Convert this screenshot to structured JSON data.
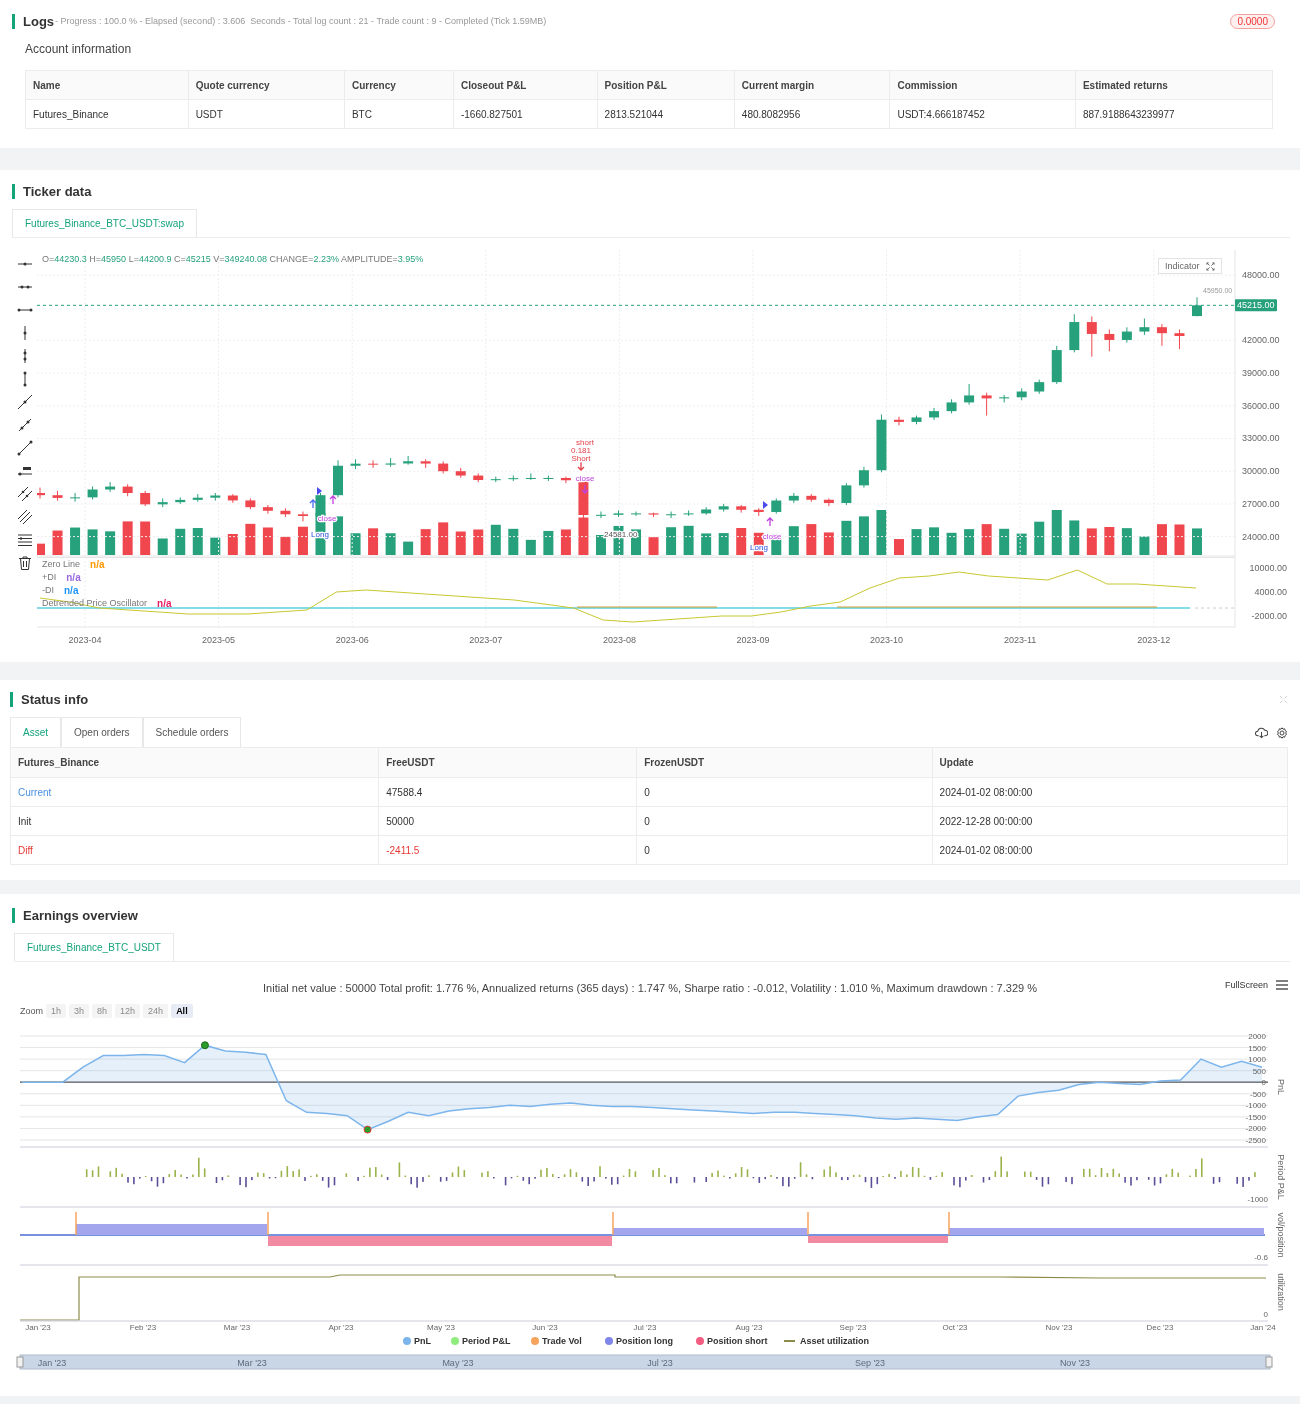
{
  "logs": {
    "title": "Logs",
    "summary": "- Progress : 100.0 % - Elapsed (second) : 3.606  Seconds - Total log count : 21 - Trade count : 9 - Completed (Tick 1.59MB)",
    "badge": "0.0000",
    "account": {
      "title": "Account information",
      "columns": [
        "Name",
        "Quote currency",
        "Currency",
        "Closeout P&L",
        "Position P&L",
        "Current margin",
        "Commission",
        "Estimated returns"
      ],
      "rows": [
        [
          "Futures_Binance",
          "USDT",
          "BTC",
          "-1660.827501",
          "2813.521044",
          "480.8082956",
          "USDT:4.666187452",
          "887.9188643239977"
        ]
      ]
    }
  },
  "ticker": {
    "title": "Ticker data",
    "tabs": [
      {
        "label": "Futures_Binance_BTC_USDT:swap",
        "selected": true
      }
    ],
    "ohlc": [
      {
        "label": "O=",
        "value": "44230.3"
      },
      {
        "label": "H=",
        "value": "45950"
      },
      {
        "label": "L=",
        "value": "44200.9"
      },
      {
        "label": "C=",
        "value": "45215"
      },
      {
        "label": "V=",
        "value": "349240.08"
      },
      {
        "label": "CHANGE=",
        "value": "2.23%"
      },
      {
        "label": "AMPLITUDE=",
        "value": "3.95%"
      }
    ],
    "indicator_button": "Indicator",
    "high_label": "45950.00",
    "last_price": "45215.00",
    "price_chart": {
      "chart_data": {
        "type": "candlestick",
        "ylim": [
          22130,
          50290
        ],
        "grid": true,
        "yticks": [
          {
            "value": 48000,
            "label": "48000.00"
          },
          {
            "value": 42000,
            "label": "42000.00"
          },
          {
            "value": 39000,
            "label": "39000.00"
          },
          {
            "value": 36000,
            "label": "36000.00"
          },
          {
            "value": 33000,
            "label": "33000.00"
          },
          {
            "value": 30000,
            "label": "30000.00"
          },
          {
            "value": 27000,
            "label": "27000.00"
          },
          {
            "value": 24000,
            "label": "24000.00"
          }
        ],
        "ohlc": [
          [
            28000,
            28500,
            27500,
            27800
          ],
          [
            27800,
            28200,
            27300,
            27550
          ],
          [
            27550,
            28000,
            27200,
            27600
          ],
          [
            27600,
            28600,
            27400,
            28320
          ],
          [
            28320,
            29000,
            28100,
            28590
          ],
          [
            28590,
            28800,
            27700,
            28000
          ],
          [
            28000,
            28200,
            26800,
            26960
          ],
          [
            26960,
            27500,
            26700,
            27160
          ],
          [
            27160,
            27600,
            27000,
            27370
          ],
          [
            27370,
            27900,
            27200,
            27570
          ],
          [
            27570,
            28000,
            27300,
            27770
          ],
          [
            27770,
            27900,
            27100,
            27320
          ],
          [
            27320,
            27500,
            26500,
            26700
          ],
          [
            26700,
            26900,
            26100,
            26370
          ],
          [
            26370,
            26600,
            25800,
            26050
          ],
          [
            26050,
            26300,
            25400,
            25890
          ],
          [
            25890,
            28000,
            25700,
            27800
          ],
          [
            27800,
            31000,
            27600,
            30500
          ],
          [
            30500,
            31100,
            30200,
            30690
          ],
          [
            30690,
            31000,
            30300,
            30600
          ],
          [
            30600,
            31200,
            30400,
            30710
          ],
          [
            30710,
            31400,
            30600,
            30910
          ],
          [
            30910,
            31100,
            30300,
            30700
          ],
          [
            30700,
            30900,
            29800,
            30000
          ],
          [
            30000,
            30300,
            29400,
            29600
          ],
          [
            29600,
            29800,
            29000,
            29190
          ],
          [
            29190,
            29500,
            29000,
            29270
          ],
          [
            29270,
            29600,
            29100,
            29360
          ],
          [
            29360,
            29800,
            29200,
            29380
          ],
          [
            29380,
            29600,
            29100,
            29380
          ],
          [
            29380,
            29500,
            28900,
            29170
          ],
          [
            29170,
            29300,
            25400,
            25980
          ],
          [
            25980,
            26300,
            25700,
            26000
          ],
          [
            26000,
            26400,
            25800,
            26130
          ],
          [
            26130,
            26300,
            25900,
            26130
          ],
          [
            26130,
            26200,
            25800,
            26020
          ],
          [
            26020,
            26300,
            25700,
            26050
          ],
          [
            26050,
            26400,
            25900,
            26130
          ],
          [
            26130,
            26700,
            26000,
            26490
          ],
          [
            26490,
            27000,
            26300,
            26780
          ],
          [
            26780,
            26900,
            26200,
            26460
          ],
          [
            26460,
            26600,
            25900,
            26260
          ],
          [
            26260,
            27500,
            26100,
            27310
          ],
          [
            27310,
            28000,
            27100,
            27740
          ],
          [
            27740,
            27900,
            27200,
            27380
          ],
          [
            27380,
            27500,
            26800,
            27080
          ],
          [
            27080,
            28900,
            26900,
            28700
          ],
          [
            28700,
            30400,
            28500,
            30090
          ],
          [
            30090,
            35200,
            29900,
            34720
          ],
          [
            34720,
            35000,
            34200,
            34520
          ],
          [
            34520,
            35100,
            34300,
            34930
          ],
          [
            34930,
            35800,
            34700,
            35510
          ],
          [
            35510,
            36600,
            35300,
            36310
          ],
          [
            36310,
            38000,
            36100,
            36950
          ],
          [
            36950,
            37200,
            35100,
            36680
          ],
          [
            36680,
            37000,
            36300,
            36780
          ],
          [
            36780,
            37600,
            36500,
            37310
          ],
          [
            37310,
            38400,
            37100,
            38170
          ],
          [
            38170,
            41500,
            38000,
            41110
          ],
          [
            41110,
            44400,
            40900,
            43680
          ],
          [
            43680,
            44200,
            40500,
            42590
          ],
          [
            42590,
            43000,
            41000,
            42040
          ],
          [
            42040,
            43200,
            41800,
            42810
          ],
          [
            42810,
            44000,
            42500,
            43210
          ],
          [
            43210,
            43500,
            41500,
            42660
          ],
          [
            42660,
            43000,
            41200,
            42400
          ],
          [
            44230.3,
            45950,
            44200.9,
            45215
          ]
        ]
      }
    },
    "dates": [
      "2023-04",
      "2023-05",
      "2023-06",
      "2023-07",
      "2023-08",
      "2023-09",
      "2023-10",
      "2023-11",
      "2023-12"
    ],
    "legend": [
      {
        "name": "Zero Line",
        "value": "n/a",
        "color": "#ff9800"
      },
      {
        "name": "+DI",
        "value": "n/a",
        "color": "#9c6ade"
      },
      {
        "name": "-DI",
        "value": "n/a",
        "color": "#2196f3"
      }
    ],
    "osc_chart": {
      "legend": {
        "value": "n/a",
        "color": "#e91e63"
      },
      "chart_data": {
        "type": "line",
        "ylim": [
          -4750,
          12750
        ],
        "yticks": [
          {
            "value": 10000,
            "label": "10000.00"
          },
          {
            "value": 4000,
            "label": "4000.00"
          },
          {
            "value": -2000,
            "label": "-2000.00"
          }
        ],
        "series": [
          {
            "name": "Detrended Price Oscillator",
            "color": "#c8c832",
            "values": [
              2500,
              1500,
              0,
              -500,
              -1000,
              -1500,
              -1500,
              -1500,
              -1000,
              -500,
              4000,
              4500,
              4000,
              3500,
              3000,
              2500,
              2000,
              1000,
              0,
              -3000,
              -3500,
              -3000,
              -2500,
              -2000,
              -2000,
              -1000,
              500,
              1500,
              5000,
              7500,
              8000,
              9000,
              8000,
              7500,
              7000,
              9500,
              6000,
              6000,
              5500,
              5000
            ]
          }
        ]
      }
    },
    "markers": [
      {
        "text": "short",
        "kind": "short"
      },
      {
        "text": "0.181",
        "kind": "short"
      },
      {
        "text": "Short",
        "kind": "short"
      },
      {
        "text": "close",
        "kind": "close"
      },
      {
        "text": "close",
        "kind": "close"
      },
      {
        "text": "Long",
        "kind": "long"
      },
      {
        "text": "24581.00",
        "kind": "low"
      },
      {
        "text": "close",
        "kind": "close"
      },
      {
        "text": "Long",
        "kind": "long"
      }
    ]
  },
  "status": {
    "title": "Status info",
    "tabs": [
      {
        "label": "Asset",
        "selected": true
      },
      {
        "label": "Open orders",
        "selected": false
      },
      {
        "label": "Schedule orders",
        "selected": false
      }
    ],
    "columns": [
      "Futures_Binance",
      "FreeUSDT",
      "FrozenUSDT",
      "Update"
    ],
    "rows": [
      {
        "kind": "current",
        "cells": [
          "Current",
          "47588.4",
          "0",
          "2024-01-02 08:00:00"
        ]
      },
      {
        "kind": "init",
        "cells": [
          "Init",
          "50000",
          "0",
          "2022-12-28 00:00:00"
        ]
      },
      {
        "kind": "diff",
        "cells": [
          "Diff",
          "-2411.5",
          "0",
          "2024-01-02 08:00:00"
        ]
      }
    ]
  },
  "earnings": {
    "title": "Earnings overview",
    "tabs": [
      {
        "label": "Futures_Binance_BTC_USDT",
        "selected": true
      }
    ],
    "summary": "Initial net value : 50000 Total profit: 1.776 %, Annualized returns (365 days) : 1.747 %, Sharpe ratio : -0.012, Volatility : 1.010 %, Maximum drawdown : 7.329 %",
    "fullscreen": "FullScreen",
    "zoom_label": "Zoom",
    "zoom_buttons": [
      {
        "label": "1h",
        "disabled": true,
        "selected": false
      },
      {
        "label": "3h",
        "disabled": true,
        "selected": false
      },
      {
        "label": "8h",
        "disabled": true,
        "selected": false
      },
      {
        "label": "12h",
        "disabled": true,
        "selected": false
      },
      {
        "label": "24h",
        "disabled": true,
        "selected": false
      },
      {
        "label": "All",
        "disabled": false,
        "selected": true
      }
    ],
    "pnl_chart": {
      "chart_data": {
        "type": "line",
        "ylabel": "PnL",
        "grid": true,
        "ylim": [
          -2500,
          2000
        ],
        "yticks": [
          2000,
          1500,
          1000,
          500,
          0,
          -500,
          -1000,
          -1500,
          -2000,
          -2500
        ],
        "series": [
          {
            "name": "PnL",
            "color": "#7cb5ec",
            "values": [
              0,
              0,
              0,
              650,
              1150,
              1150,
              1200,
              1150,
              850,
              1600,
              1350,
              1300,
              1200,
              -800,
              -1300,
              -1350,
              -1450,
              -2050,
              -1700,
              -1300,
              -1450,
              -1250,
              -1150,
              -1100,
              -1000,
              -1050,
              -950,
              -900,
              -1000,
              -1050,
              -1050,
              -1100,
              -1150,
              -1200,
              -1250,
              -1300,
              -1350,
              -1300,
              -1300,
              -1350,
              -1400,
              -1450,
              -1550,
              -1600,
              -1550,
              -1600,
              -1650,
              -1500,
              -1400,
              -600,
              -450,
              -350,
              -100,
              0,
              -50,
              -100,
              50,
              100,
              1000,
              650,
              900,
              650
            ]
          }
        ]
      }
    },
    "period_axis": {
      "label": "Period P&L",
      "tick": "-1000"
    },
    "position_axis": {
      "label": "vol/position",
      "tick": "-0.6"
    },
    "utilization_axis": {
      "label": "utilization",
      "tick": "0"
    },
    "x_labels": [
      "Jan '23",
      "Feb '23",
      "Mar '23",
      "Apr '23",
      "May '23",
      "Jun '23",
      "Jul '23",
      "Aug '23",
      "Sep '23",
      "Oct '23",
      "Nov '23",
      "Dec '23",
      "Jan '24"
    ],
    "legend": [
      {
        "color": "#7cb5ec",
        "kind": "dot"
      },
      {
        "label": "Period P&L",
        "color": "#90ed7d",
        "kind": "dot"
      },
      {
        "label": "Trade Vol",
        "color": "#f7a35c",
        "kind": "dot"
      },
      {
        "label": "Position long",
        "color": "#8085e9",
        "kind": "dot"
      },
      {
        "label": "Position short",
        "color": "#f15c80",
        "kind": "dot"
      },
      {
        "label": "Asset utilization",
        "color": "#8d8b4a",
        "kind": "line"
      }
    ],
    "navigator_labels": [
      "Jan '23",
      "Mar '23",
      "May '23",
      "Jul '23",
      "Sep '23",
      "Nov '23"
    ]
  }
}
